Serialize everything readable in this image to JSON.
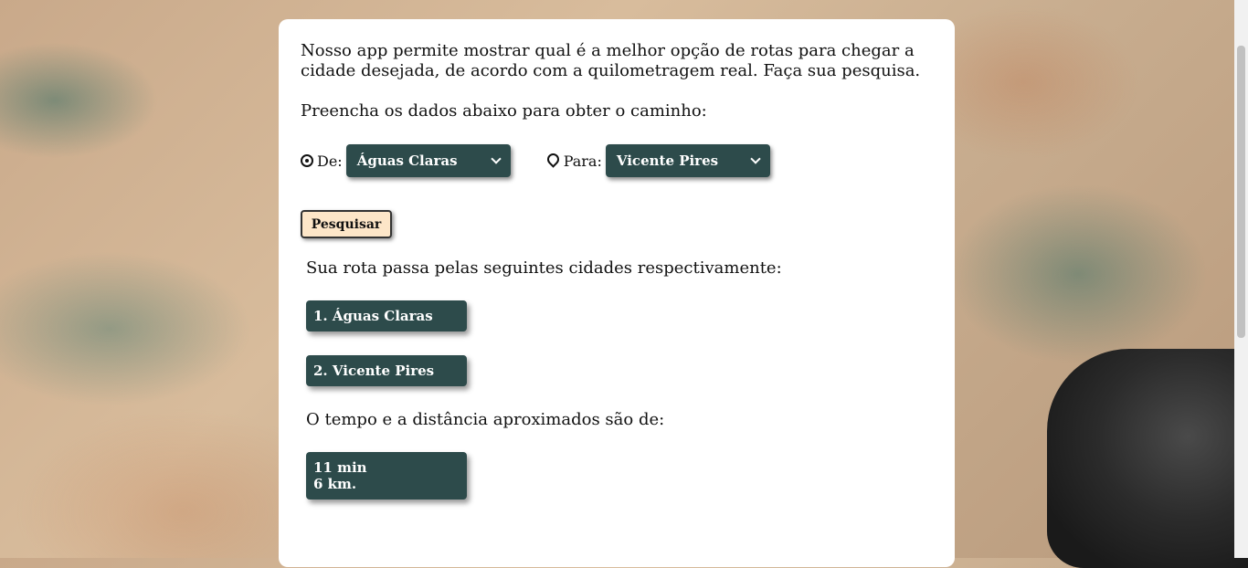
{
  "intro_text": "Nosso app permite mostrar qual é a melhor opção de rotas para chegar a cidade desejada, de acordo com a quilometragem real. Faça sua pesquisa.",
  "prompt_text": "Preencha os dados abaixo para obter o caminho:",
  "from": {
    "label": "De:",
    "icon": "dot-circle-icon",
    "value": "Águas Claras"
  },
  "to": {
    "label": "Para:",
    "icon": "map-marker-icon",
    "value": "Vicente Pires"
  },
  "search_button": "Pesquisar",
  "route_title": "Sua rota passa pelas seguintes cidades respectivamente:",
  "route_cities": [
    "1. Águas Claras",
    "2. Vicente Pires"
  ],
  "time_title": "O tempo e a distância aproximados são de:",
  "result": {
    "time": "11 min",
    "distance": "6 km."
  },
  "colors": {
    "accent": "#2d4b4b",
    "button_bg": "#fde6c8"
  }
}
